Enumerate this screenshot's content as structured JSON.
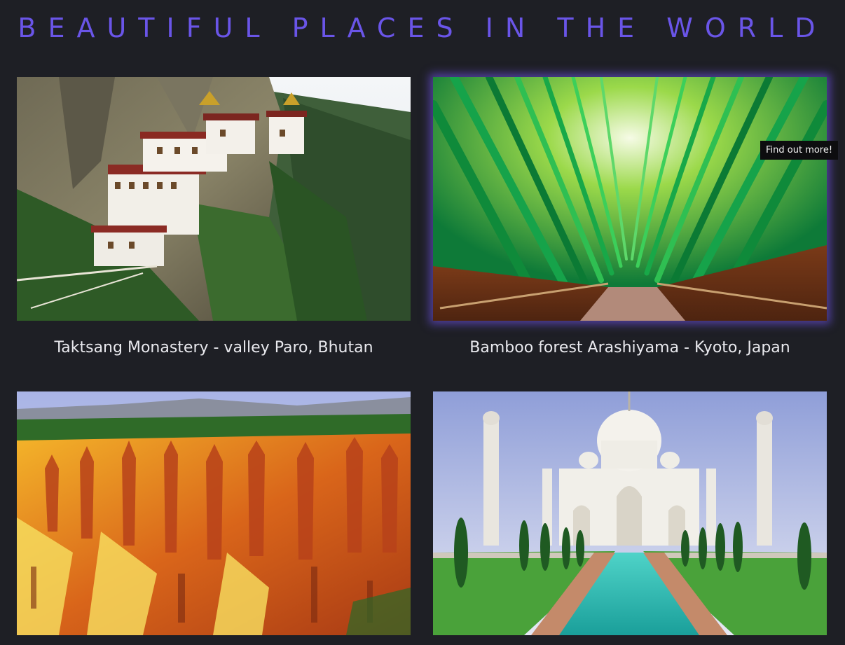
{
  "header": {
    "title": "BEAUTIFUL PLACES IN THE WORLD",
    "title_color": "#6a55e8"
  },
  "places": [
    {
      "caption": "Taktsang Monastery - valley Paro, Bhutan"
    },
    {
      "caption": "Bamboo forest Arashiyama - Kyoto, Japan",
      "hovered": true
    },
    {
      "caption": ""
    },
    {
      "caption": ""
    }
  ],
  "tooltip": {
    "text": "Find out more!"
  },
  "colors": {
    "background": "#1e1f25",
    "accent_glow": "#785aff",
    "caption_text": "#e9e9ee"
  }
}
